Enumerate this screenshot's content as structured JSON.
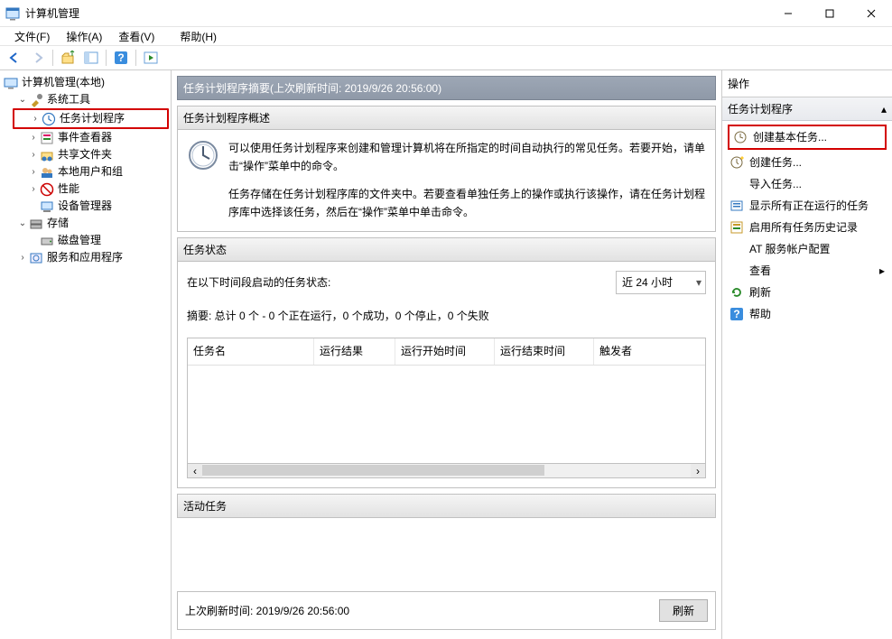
{
  "window": {
    "title": "计算机管理"
  },
  "menu": [
    "文件(F)",
    "操作(A)",
    "查看(V)",
    "帮助(H)"
  ],
  "tree": {
    "root": "计算机管理(本地)",
    "tools_group": "系统工具",
    "scheduler": "任务计划程序",
    "eventviewer": "事件查看器",
    "shared": "共享文件夹",
    "localusers": "本地用户和组",
    "perf": "性能",
    "devmgr": "设备管理器",
    "storage_group": "存储",
    "diskmgmt": "磁盘管理",
    "services_group": "服务和应用程序"
  },
  "center": {
    "summary_header": "任务计划程序摘要(上次刷新时间: 2019/9/26 20:56:00)",
    "overview_title": "任务计划程序概述",
    "overview_p1": "可以使用任务计划程序来创建和管理计算机将在所指定的时间自动执行的常见任务。若要开始，请单击“操作”菜单中的命令。",
    "overview_p2": "任务存储在任务计划程序库的文件夹中。若要查看单独任务上的操作或执行该操作，请在任务计划程序库中选择该任务，然后在“操作”菜单中单击命令。",
    "status_title": "任务状态",
    "status_label": "在以下时间段启动的任务状态:",
    "status_range": "近 24 小时",
    "status_summary": "摘要: 总计 0 个 - 0 个正在运行，0 个成功，0 个停止，0 个失败",
    "cols": [
      "任务名",
      "运行结果",
      "运行开始时间",
      "运行结束时间",
      "触发者"
    ],
    "active_title": "活动任务",
    "last_refresh": "上次刷新时间: 2019/9/26 20:56:00",
    "refresh_btn": "刷新"
  },
  "actions": {
    "panel_title": "操作",
    "subheader": "任务计划程序",
    "items": [
      "创建基本任务...",
      "创建任务...",
      "导入任务...",
      "显示所有正在运行的任务",
      "启用所有任务历史记录",
      "AT 服务帐户配置",
      "查看",
      "刷新",
      "帮助"
    ]
  }
}
